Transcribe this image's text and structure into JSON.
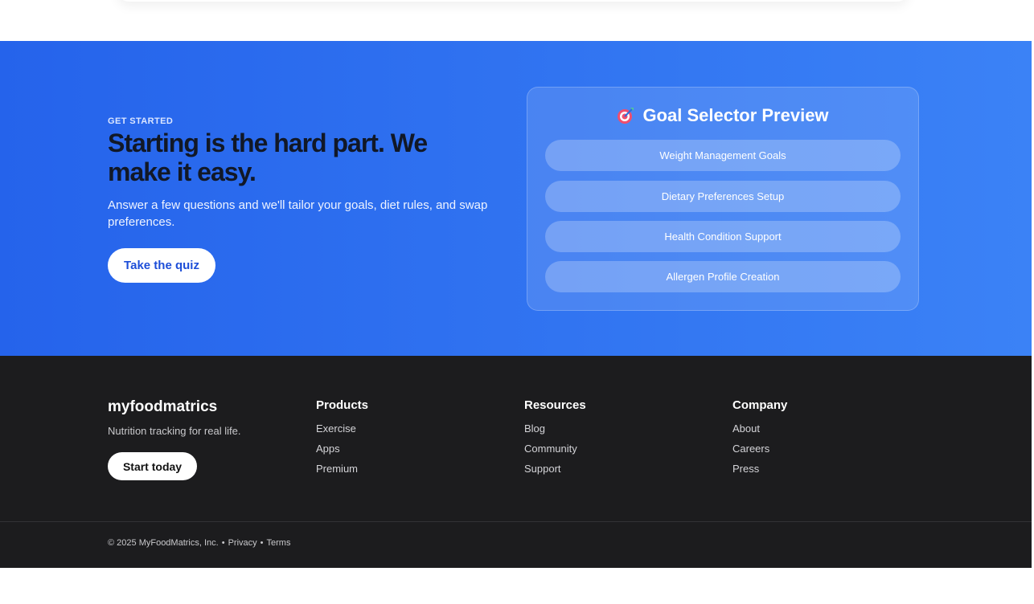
{
  "cta": {
    "eyebrow": "GET STARTED",
    "headline": "Starting is the hard part. We make it easy.",
    "subtext": "Answer a few questions and we'll tailor your goals, diet rules, and swap preferences.",
    "button_label": "Take the quiz"
  },
  "goal_selector": {
    "icon": "target-icon",
    "title": "Goal Selector Preview",
    "options": [
      "Weight Management Goals",
      "Dietary Preferences Setup",
      "Health Condition Support",
      "Allergen Profile Creation"
    ]
  },
  "footer": {
    "brand": "myfoodmatrics",
    "tagline": "Nutrition tracking for real life.",
    "button_label": "Start today",
    "columns": [
      {
        "heading": "Products",
        "links": [
          "Exercise",
          "Apps",
          "Premium"
        ]
      },
      {
        "heading": "Resources",
        "links": [
          "Blog",
          "Community",
          "Support"
        ]
      },
      {
        "heading": "Company",
        "links": [
          "About",
          "Careers",
          "Press"
        ]
      }
    ],
    "legal": {
      "copyright": "© 2025 MyFoodMatrics, Inc.",
      "sep": "•",
      "privacy": "Privacy",
      "terms": "Terms"
    }
  },
  "colors": {
    "cta_gradient_start": "#2563eb",
    "cta_gradient_end": "#3b82f6",
    "footer_bg": "#1c1c1e"
  }
}
